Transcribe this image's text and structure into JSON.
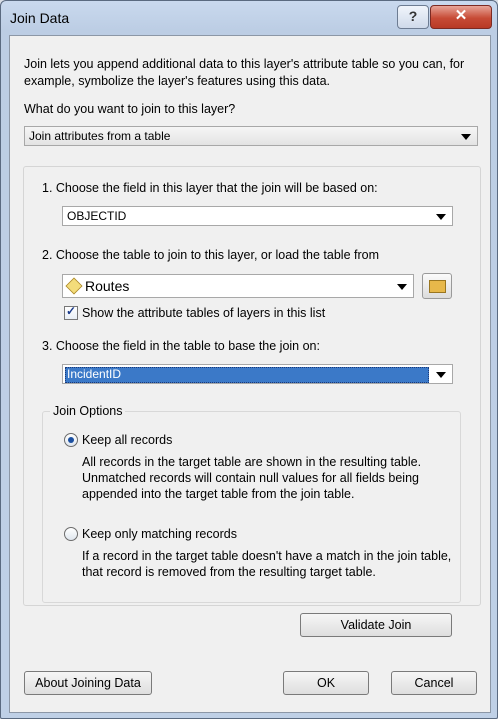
{
  "window": {
    "title": "Join Data",
    "help_label": "?",
    "close_label": "✕"
  },
  "intro": "Join lets you append additional data to this layer's attribute table so you can, for example, symbolize the layer's features using this data.",
  "question": "What do you want to join to this layer?",
  "join_type": {
    "value": "Join attributes from a table"
  },
  "step1": {
    "label": "1.  Choose the field in this layer that the join will be based on:",
    "value": "OBJECTID"
  },
  "step2": {
    "label": "2.  Choose the table to join to this layer, or load the table from",
    "value": "Routes",
    "checkbox_label": "Show the attribute tables of layers in this list",
    "checked": true
  },
  "step3": {
    "label": "3.  Choose the field in the table to base the join on:",
    "value": "IncidentID"
  },
  "join_options": {
    "legend": "Join Options",
    "keep_all": {
      "label": "Keep all records",
      "desc": "All records in the target table are shown in the resulting table. Unmatched records will contain null values for all fields being appended into the target table from the join table.",
      "selected": true
    },
    "keep_matching": {
      "label": "Keep only matching records",
      "desc": "If a record in the target table doesn't have a match in the join table, that record is removed from the resulting target table.",
      "selected": false
    }
  },
  "buttons": {
    "validate": "Validate Join",
    "about": "About Joining Data",
    "ok": "OK",
    "cancel": "Cancel"
  }
}
